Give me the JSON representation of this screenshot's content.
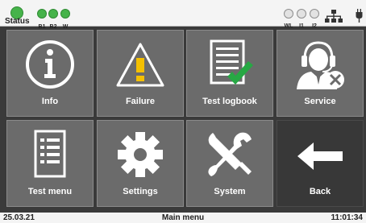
{
  "statusbar": {
    "status_label": "Status",
    "indicators_left": [
      {
        "label": "B1",
        "state": "on"
      },
      {
        "label": "B2",
        "state": "on"
      },
      {
        "label": "W",
        "state": "on"
      }
    ],
    "indicators_right": [
      {
        "label": "WL",
        "state": "off"
      },
      {
        "label": "I1",
        "state": "off"
      },
      {
        "label": "I2",
        "state": "off"
      }
    ],
    "icons": [
      "network-icon",
      "plug-icon"
    ]
  },
  "menu": {
    "tiles": [
      {
        "id": "info",
        "label": "Info",
        "icon": "info-icon"
      },
      {
        "id": "failure",
        "label": "Failure",
        "icon": "warning-icon"
      },
      {
        "id": "test-logbook",
        "label": "Test logbook",
        "icon": "checklist-icon"
      },
      {
        "id": "service",
        "label": "Service",
        "icon": "support-agent-icon"
      },
      {
        "id": "test-menu",
        "label": "Test menu",
        "icon": "list-icon"
      },
      {
        "id": "settings",
        "label": "Settings",
        "icon": "gear-icon"
      },
      {
        "id": "system",
        "label": "System",
        "icon": "tools-icon"
      },
      {
        "id": "back",
        "label": "Back",
        "icon": "arrow-left-icon"
      }
    ]
  },
  "footer": {
    "date": "25.03.21",
    "title": "Main menu",
    "time": "11:01:34"
  },
  "colors": {
    "tile": "#6b6b6b",
    "tile_active": "#383838",
    "led_on": "#46b34a",
    "warning": "#f5c000",
    "check": "#27a844"
  }
}
